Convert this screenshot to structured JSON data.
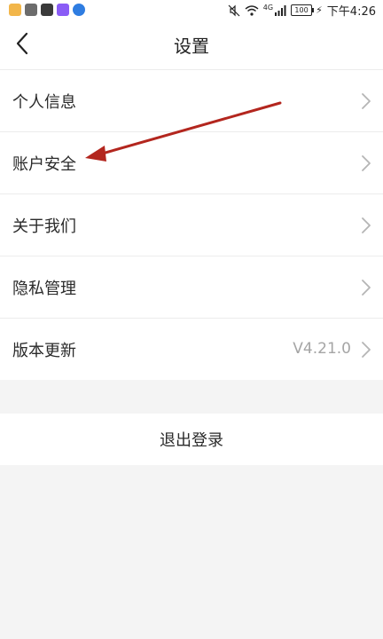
{
  "status_bar": {
    "time": "下午4:26",
    "battery": "100",
    "network": "4G",
    "app_icons": [
      {
        "name": "notes-app-icon",
        "color": "#f2b64a"
      },
      {
        "name": "message-app-icon",
        "color": "#6c6c6c"
      },
      {
        "name": "wechat-app-icon",
        "color": "#3a3a3a"
      },
      {
        "name": "purple-app-icon",
        "color": "#8a5cf6"
      },
      {
        "name": "blue-app-icon",
        "color": "#2f7de1"
      }
    ]
  },
  "header": {
    "title": "设置",
    "back_icon": "chevron-left-icon"
  },
  "settings": {
    "items": [
      {
        "label": "个人信息",
        "value": ""
      },
      {
        "label": "账户安全",
        "value": ""
      },
      {
        "label": "关于我们",
        "value": ""
      },
      {
        "label": "隐私管理",
        "value": ""
      },
      {
        "label": "版本更新",
        "value": "V4.21.0"
      }
    ]
  },
  "logout": {
    "label": "退出登录"
  },
  "colors": {
    "background": "#f4f4f4",
    "annotation_arrow": "#b3261e",
    "secondary_text": "#a5a5a5"
  }
}
